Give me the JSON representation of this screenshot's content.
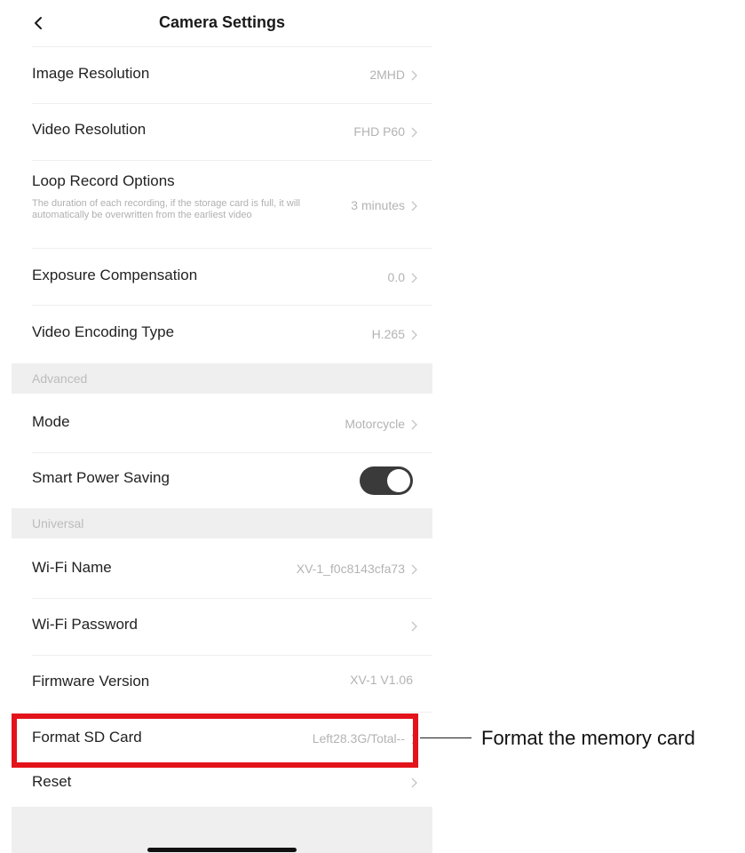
{
  "navbar": {
    "title": "Camera Settings",
    "back_icon": "chevron-left-icon"
  },
  "settings": {
    "image_resolution": {
      "label": "Image Resolution",
      "value": "2MHD"
    },
    "video_resolution": {
      "label": "Video Resolution",
      "value": "FHD P60"
    },
    "loop_record": {
      "label": "Loop Record Options",
      "description": "The duration of each recording, if the storage card is full, it will automatically be overwritten from the earliest video",
      "value": "3 minutes"
    },
    "exposure_compensation": {
      "label": "Exposure Compensation",
      "value": "0.0"
    },
    "video_encoding": {
      "label": "Video Encoding Type",
      "value": "H.265"
    }
  },
  "advanced": {
    "header": "Advanced",
    "mode": {
      "label": "Mode",
      "value": "Motorcycle"
    },
    "smart_power_saving": {
      "label": "Smart Power Saving",
      "enabled": true
    }
  },
  "universal": {
    "header": "Universal",
    "wifi_name": {
      "label": "Wi-Fi Name",
      "value": "XV-1_f0c8143cfa73"
    },
    "wifi_password": {
      "label": "Wi-Fi Password",
      "value": ""
    },
    "firmware_version": {
      "label": "Firmware Version",
      "value": "XV-1 V1.06"
    },
    "format_sd_card": {
      "label": "Format SD Card",
      "value": "Left28.3G/Total--"
    },
    "reset": {
      "label": "Reset",
      "value": ""
    }
  },
  "annotation": {
    "callout_text": "Format the memory card",
    "highlight_color": "#e3131b"
  },
  "colors": {
    "toggle_on": "#3a3a3a",
    "section_bg": "#efefef",
    "value_text": "#b3b3b3"
  }
}
